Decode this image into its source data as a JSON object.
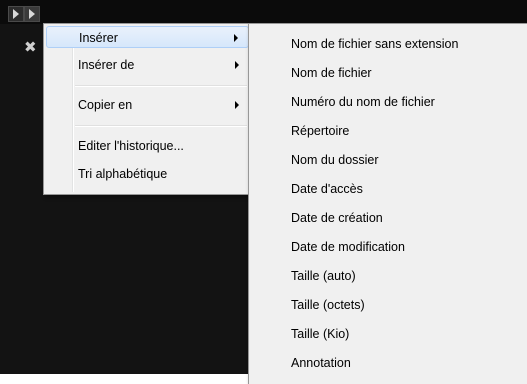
{
  "context_menu": {
    "items": [
      {
        "label": "Insérer",
        "submenu": true,
        "highlighted": true
      },
      {
        "label": "Insérer de",
        "submenu": true
      },
      {
        "label": "Copier en",
        "submenu": true
      },
      {
        "label": "Editer l'historique..."
      },
      {
        "label": "Tri alphabétique"
      }
    ]
  },
  "submenu_inserer": {
    "items": [
      "Nom de fichier sans extension",
      "Nom de fichier",
      "Numéro du nom de fichier",
      "Répertoire",
      "Nom du dossier",
      "Date d'accès",
      "Date de création",
      "Date de modification",
      "Taille (auto)",
      "Taille (octets)",
      "Taille (Kio)",
      "Annotation"
    ]
  },
  "icons": [
    "menu-toggle-icon",
    "play-icon",
    "close-icon",
    "submenu-arrow-icon"
  ],
  "colors": {
    "background": "#131313",
    "menu_bg": "#f0f0f0",
    "highlight": "#d6e7fb",
    "highlight_border": "#aecff7"
  }
}
